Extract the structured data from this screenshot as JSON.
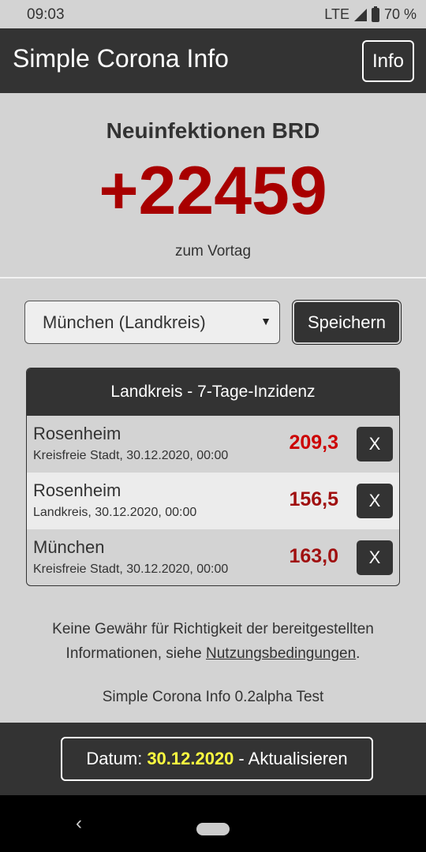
{
  "status_bar": {
    "time": "09:03",
    "network": "LTE",
    "battery": "70 %"
  },
  "app_bar": {
    "title": "Simple Corona Info",
    "info_label": "Info"
  },
  "hero": {
    "title": "Neuinfektionen BRD",
    "value": "+22459",
    "subtitle": "zum Vortag"
  },
  "selector": {
    "selected": "München (Landkreis)",
    "save_label": "Speichern"
  },
  "table": {
    "header": "Landkreis - 7-Tage-Inzidenz",
    "delete_label": "X",
    "rows": [
      {
        "name": "Rosenheim",
        "detail": "Kreisfreie Stadt, 30.12.2020, 00:00",
        "value": "209,3",
        "color": "#cc0000"
      },
      {
        "name": "Rosenheim",
        "detail": "Landkreis, 30.12.2020, 00:00",
        "value": "156,5",
        "color": "#a01010"
      },
      {
        "name": "München",
        "detail": "Kreisfreie Stadt, 30.12.2020, 00:00",
        "value": "163,0",
        "color": "#a01010"
      }
    ]
  },
  "disclaimer": {
    "line1": "Keine Gewähr für Richtigkeit der bereitgestellten",
    "line2_prefix": "Informationen, siehe",
    "link": "Nutzungsbedingungen",
    "line2_suffix": "."
  },
  "version": "Simple Corona Info 0.2alpha Test",
  "footer": {
    "prefix": "Datum:",
    "date": "30.12.2020",
    "suffix": "- Aktualisieren"
  },
  "colors": {
    "app_bar": "#333333",
    "background": "#d3d3d3",
    "hero_value": "#a80000",
    "date_highlight": "#ffff40"
  },
  "icons": {
    "signal": "signal-icon",
    "battery": "battery-icon",
    "dropdown": "caret-down-icon",
    "back": "back-icon",
    "home": "home-pill-icon"
  }
}
